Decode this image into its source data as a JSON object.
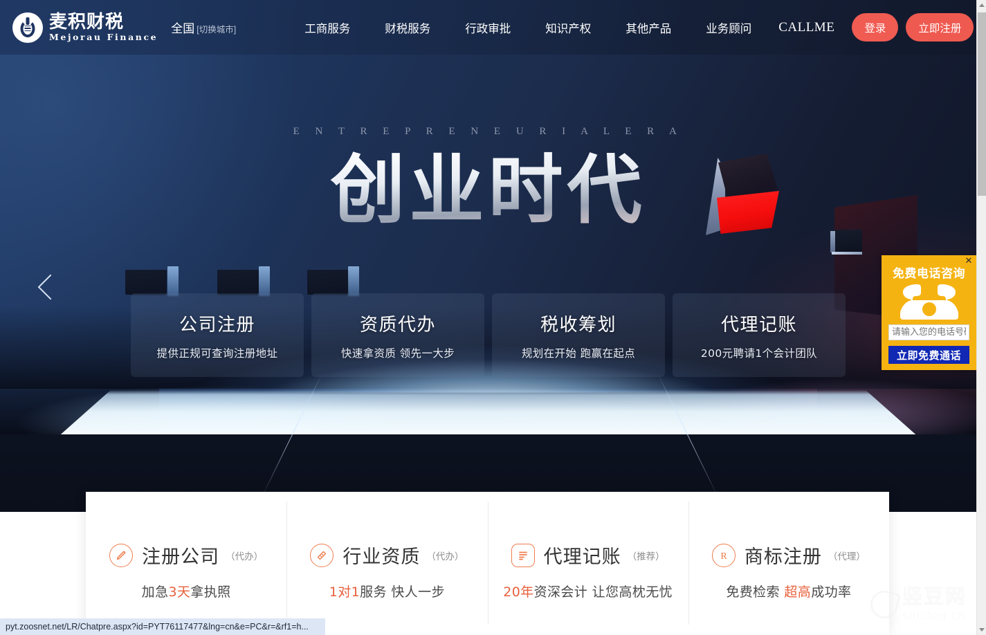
{
  "brand": {
    "cn_name": "麦积财税",
    "en_name": "Mejorau Finance",
    "city": "全国",
    "city_switch": "[切换城市]"
  },
  "nav": {
    "items": [
      {
        "label": "工商服务",
        "latin": false
      },
      {
        "label": "财税服务",
        "latin": false
      },
      {
        "label": "行政审批",
        "latin": false
      },
      {
        "label": "知识产权",
        "latin": false
      },
      {
        "label": "其他产品",
        "latin": false
      },
      {
        "label": "业务顾问",
        "latin": false
      },
      {
        "label": "CALLME",
        "latin": true
      }
    ],
    "login_label": "登录",
    "register_label": "立即注册",
    "accent_color": "#f05b52"
  },
  "hero": {
    "eyebrow": "E N T R E P R E N E U R I A L    E R A",
    "title": "创业时代",
    "prev_arrow": "‹",
    "cards": [
      {
        "title": "公司注册",
        "subtitle": "提供正规可查询注册地址"
      },
      {
        "title": "资质代办",
        "subtitle": "快速拿资质 领先一大步"
      },
      {
        "title": "税收筹划",
        "subtitle": "规划在开始 跑赢在起点"
      },
      {
        "title": "代理记账",
        "subtitle": "200元聘请1个会计团队"
      }
    ]
  },
  "features": [
    {
      "icon": "pencil-circle-icon",
      "title": "注册公司",
      "tag": "（代办）",
      "sub_prefix": "加急",
      "sub_highlight": "3天",
      "sub_suffix": "拿执照"
    },
    {
      "icon": "certificate-circle-icon",
      "title": "行业资质",
      "tag": "（代办）",
      "sub_prefix": "",
      "sub_highlight": "1对1",
      "sub_suffix": "服务 快人一步"
    },
    {
      "icon": "ledger-icon",
      "title": "代理记账",
      "tag": "（推荐）",
      "sub_prefix": "",
      "sub_highlight": "20年",
      "sub_suffix": "资深会计 让您高枕无忧"
    },
    {
      "icon": "registered-trademark-icon",
      "title": "商标注册",
      "tag": "（代理）",
      "sub_prefix": "免费检索 ",
      "sub_highlight": "超高",
      "sub_suffix": "成功率"
    }
  ],
  "call_widget": {
    "title": "免费电话咨询",
    "close_label": "✕",
    "input_placeholder": "请输入您的电话号码",
    "input_value": "",
    "button_label": "立即免费通话",
    "bg_color": "#f5b312",
    "button_color": "#1028b4"
  },
  "watermark": {
    "cn": "竖豆网",
    "en": "shudou.cn"
  },
  "status_bar": {
    "url": "pyt.zoosnet.net/LR/Chatpre.aspx?id=PYT76117477&lng=cn&e=PC&r=&rf1=h..."
  },
  "scrollbar": {
    "up_arrow": "▲",
    "down_arrow": "▼"
  }
}
